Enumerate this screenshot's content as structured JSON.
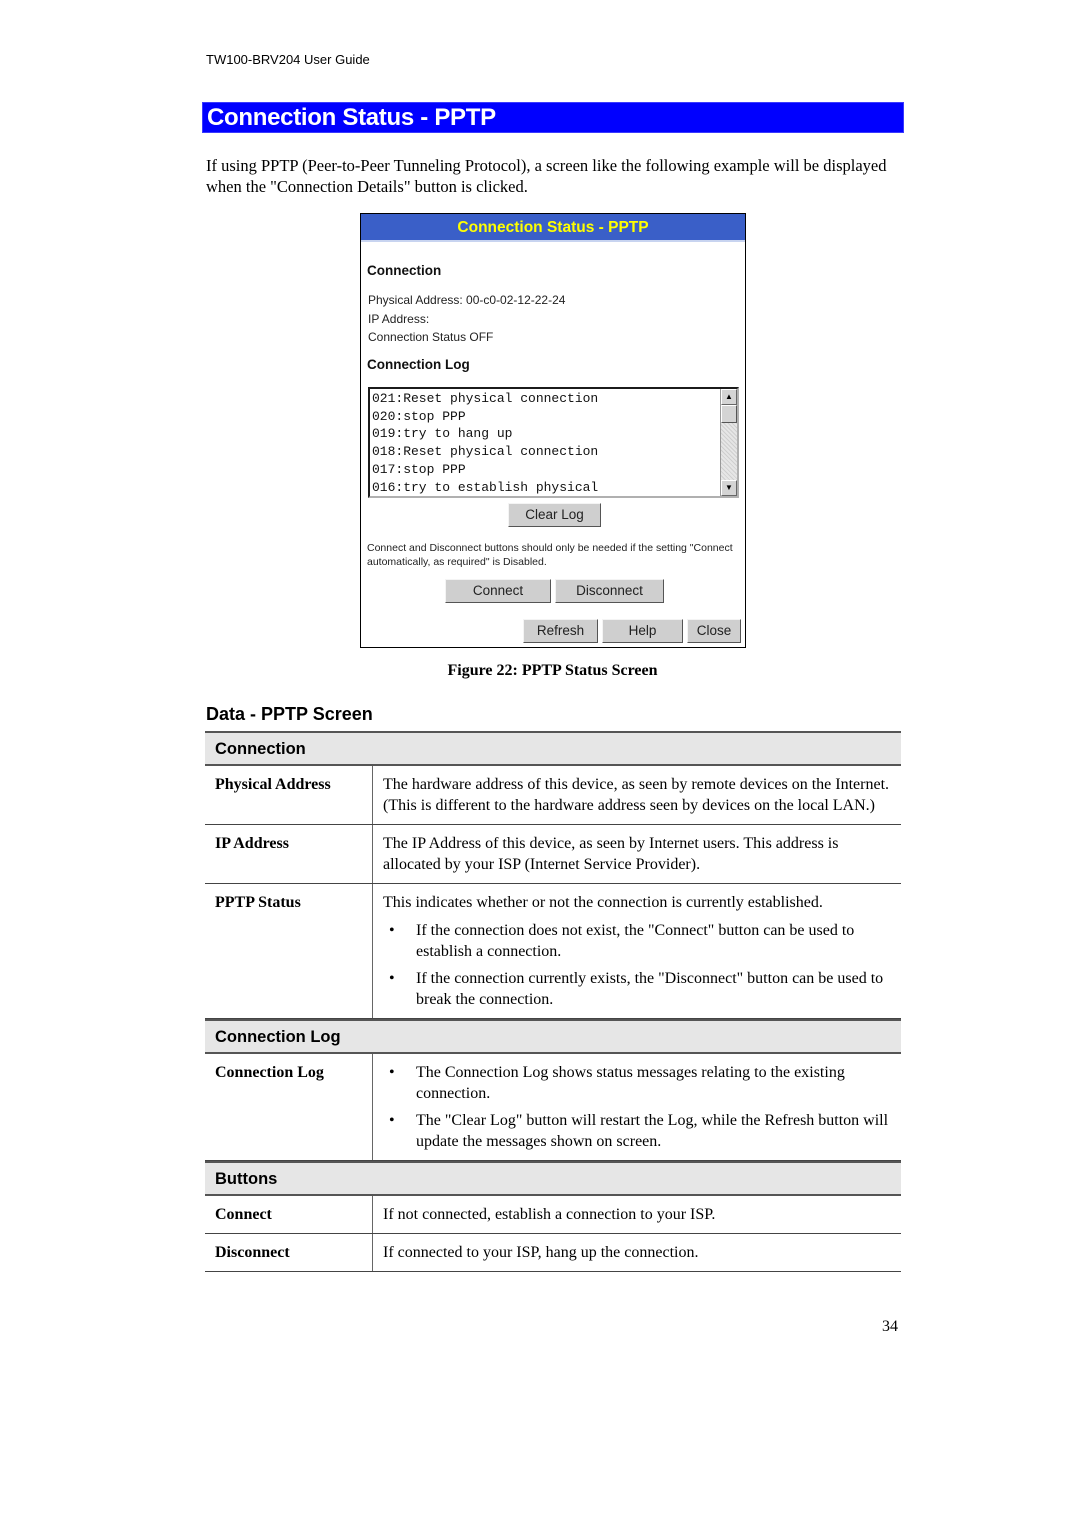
{
  "running_header": "TW100-BRV204  User Guide",
  "section_title": "Connection Status - PPTP",
  "intro": "If using PPTP (Peer-to-Peer Tunneling Protocol), a screen like the following example will be displayed when the \"Connection Details\" button is clicked.",
  "screenshot": {
    "title": "Connection Status - PPTP",
    "connection_heading": "Connection",
    "physical_address_line": "Physical Address:  00-c0-02-12-22-24",
    "ip_address_line": "IP Address:",
    "connection_status_line": "Connection Status OFF",
    "log_heading": "Connection Log",
    "log_lines": [
      "021:Reset physical connection",
      "020:stop PPP",
      "019:try to hang up",
      "018:Reset physical connection",
      "017:stop PPP",
      "016:try to establish physical"
    ],
    "scroll_up_icon": "▲",
    "scroll_down_icon": "▼",
    "clear_log_label": "Clear Log",
    "note": "Connect and Disconnect buttons should only be needed if the setting \"Connect automatically, as required\" is Disabled.",
    "connect_label": "Connect",
    "disconnect_label": "Disconnect",
    "refresh_label": "Refresh",
    "help_label": "Help",
    "close_label": "Close"
  },
  "figure_caption": "Figure 22: PPTP Status Screen",
  "subheading": "Data - PPTP Screen",
  "table": {
    "groups": [
      {
        "heading": "Connection",
        "rows": [
          {
            "label": "Physical Address",
            "text": "The hardware address of this device, as seen by remote devices on the Internet. (This is different to the hardware address seen by devices on the local LAN.)"
          },
          {
            "label": "IP Address",
            "text": "The IP Address of this device, as seen by Internet users. This address is allocated by your ISP (Internet Service Provider)."
          },
          {
            "label": "PPTP Status",
            "text": "This indicates whether or not the connection is currently established.",
            "bullets": [
              "If the connection does not exist, the \"Connect\" button can be used to establish a connection.",
              "If the connection currently exists, the \"Disconnect\" button can be used to break the connection."
            ]
          }
        ]
      },
      {
        "heading": "Connection Log",
        "rows": [
          {
            "label": "Connection Log",
            "bullets": [
              "The Connection Log shows status messages relating to the existing connection.",
              "The \"Clear Log\" button will restart the Log, while the Refresh button will update the messages shown on screen."
            ]
          }
        ]
      },
      {
        "heading": "Buttons",
        "rows": [
          {
            "label": "Connect",
            "text": "If not connected, establish a connection to your ISP."
          },
          {
            "label": "Disconnect",
            "text": "If connected to your ISP, hang up the connection."
          }
        ]
      }
    ],
    "bullet_glyph": "•"
  },
  "page_number": "34"
}
